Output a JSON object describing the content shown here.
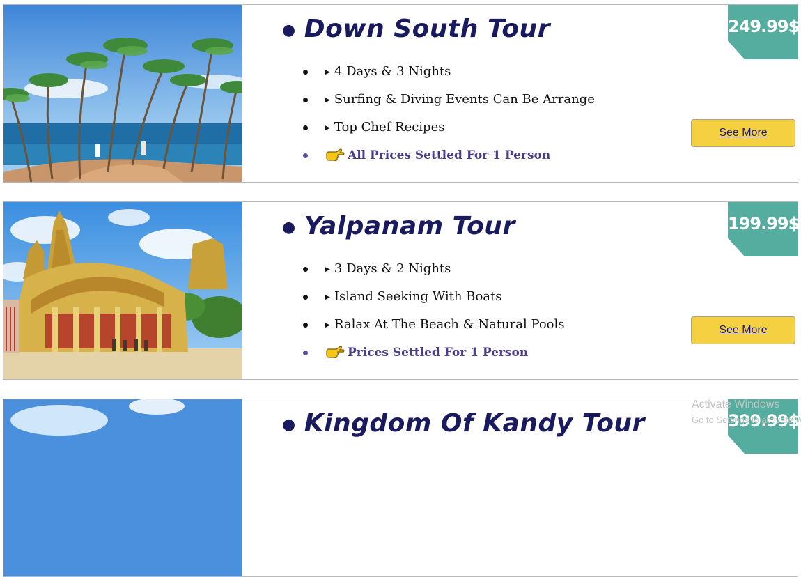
{
  "tours": [
    {
      "title": "Down South Tour",
      "price": "249.99$",
      "features": [
        "4 Days & 3 Nights",
        "Surfing & Diving Events Can Be Arrange",
        "Top Chef Recipes"
      ],
      "note": "All Prices Settled For 1 Person",
      "button_label": "See More",
      "image": "palm-tree-beach"
    },
    {
      "title": "Yalpanam Tour",
      "price": "199.99$",
      "features": [
        "3 Days & 2 Nights",
        "Island Seeking With Boats",
        "Ralax At The Beach & Natural Pools"
      ],
      "note": "Prices Settled For 1 Person",
      "button_label": "See More",
      "image": "hindu-temple"
    },
    {
      "title": "Kingdom Of Kandy Tour",
      "price": "399.99$",
      "image": "sky-landscape"
    }
  ],
  "watermark": {
    "line1": "Activate Windows",
    "line2": "Go to Settings to activate Windows."
  },
  "colors": {
    "title": "#1a1a5e",
    "price_badge": "#54ad9f",
    "button": "#f5d142",
    "note": "#4b3d8a"
  },
  "icons": {
    "note": "pointing-hand-icon",
    "feature": "triangle-bullet-icon"
  }
}
